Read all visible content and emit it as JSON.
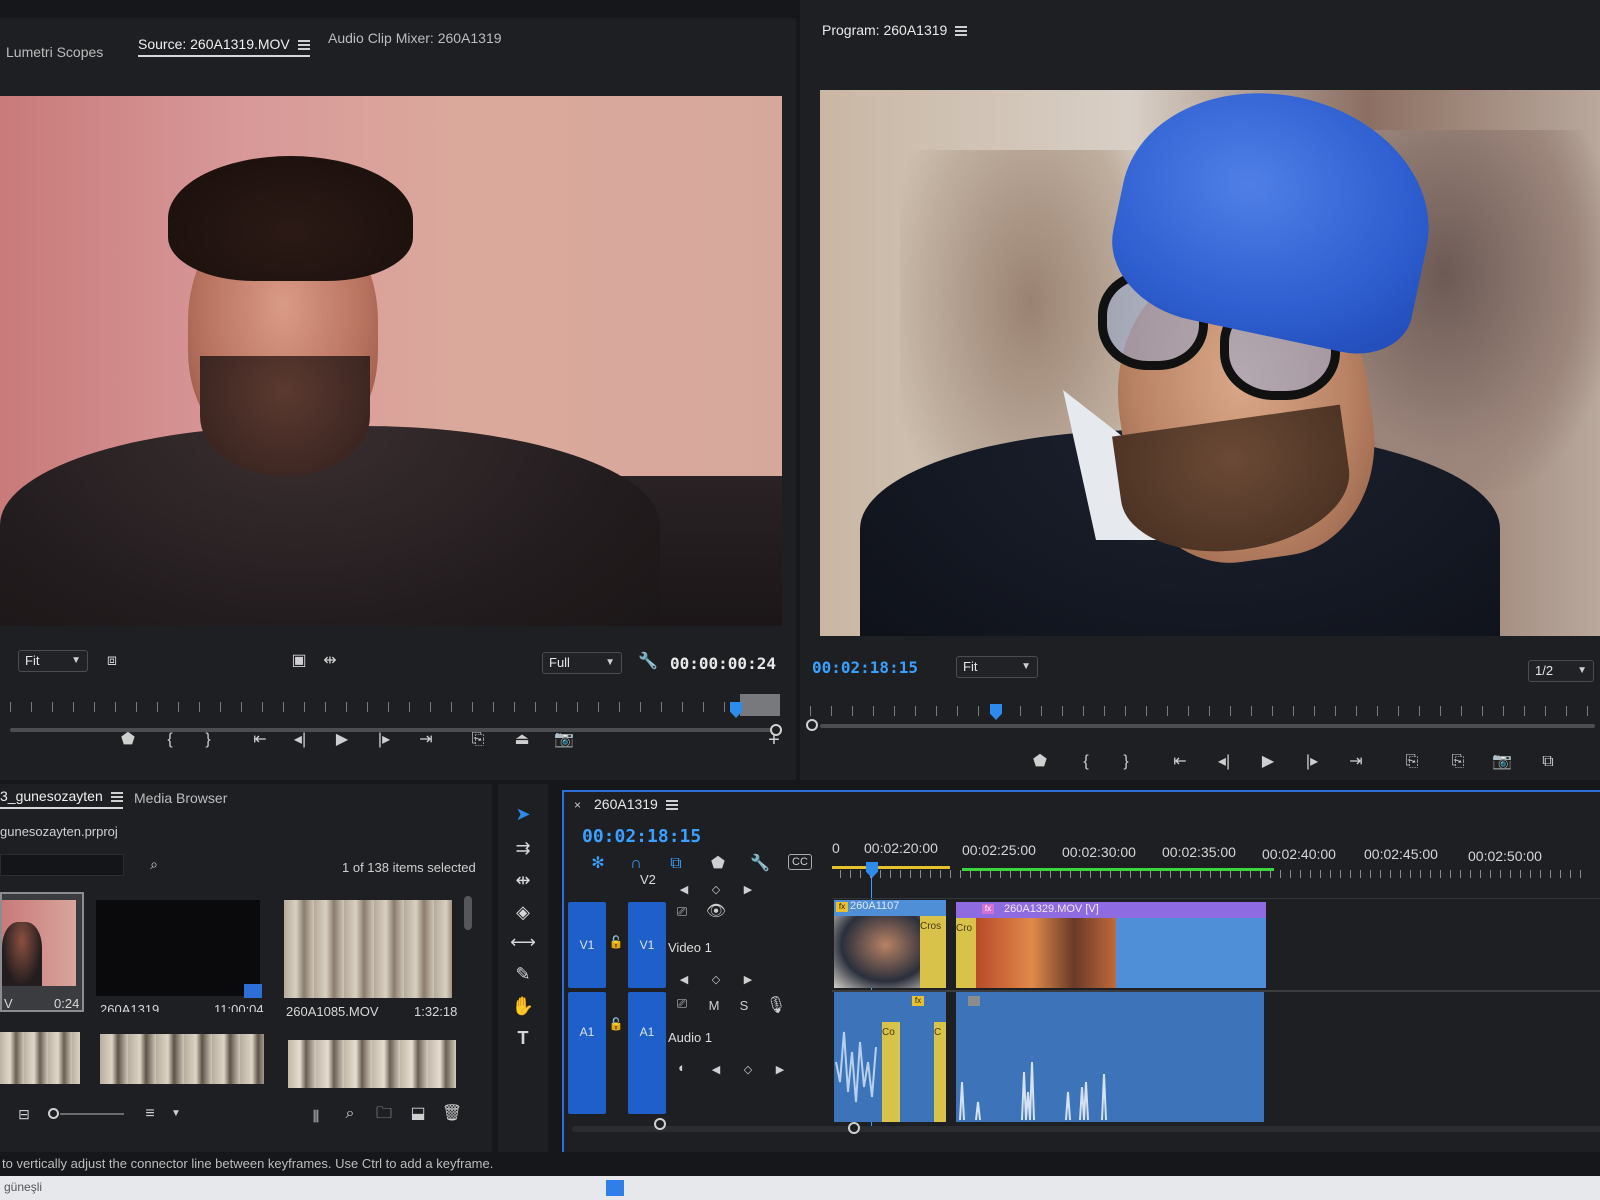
{
  "source_panel": {
    "tabs": [
      "Lumetri Scopes",
      "Source: 260A1319.MOV",
      "Audio Clip Mixer: 260A1319"
    ],
    "zoom": "Fit",
    "resolution": "Full",
    "timecode": "00:00:00:24",
    "add_button": "+"
  },
  "program_panel": {
    "title": "Program: 260A1319",
    "timecode": "00:02:18:15",
    "zoom": "Fit",
    "resolution": "1/2"
  },
  "project_panel": {
    "tab": "3_gunesozayten",
    "tab2": "Media Browser",
    "filename": "gunesozayten.prproj",
    "selection_status": "1 of 138 items selected",
    "items": [
      {
        "name": "V",
        "duration": "0:24"
      },
      {
        "name": "260A1319",
        "duration": "11:00:04"
      },
      {
        "name": "260A1085.MOV",
        "duration": "1:32:18"
      }
    ]
  },
  "timeline": {
    "sequence": "260A1319",
    "timecode": "00:02:18:15",
    "ruler": [
      "00:02:20:00",
      "00:02:25:00",
      "00:02:30:00",
      "00:02:35:00",
      "00:02:40:00",
      "00:02:45:00",
      "00:02:50:00"
    ],
    "tracks": {
      "v2": "V2",
      "v1_src": "V1",
      "v1": "V1",
      "video1": "Video 1",
      "a1_src": "A1",
      "a1": "A1",
      "audio1": "Audio 1",
      "m": "M",
      "s": "S"
    },
    "clips": {
      "clip1": "260A1107",
      "clip2": "260A1329.MOV [V]",
      "cross1": "Cros",
      "cross2": "Cro",
      "audio_co": "Co",
      "audio_c": "C"
    }
  },
  "status_bar": {
    "hint": "to vertically adjust the connector line between keyframes. Use Ctrl to add a keyframe.",
    "taskbar_text": "güneşli"
  },
  "colors": {
    "accent_blue": "#2d8ceb",
    "timecode_blue": "#3aa0ff",
    "track_blue": "#1f5fc9",
    "clip_blue": "#4f8fd8",
    "audio_blue": "#3d73b8",
    "clip_label_purple": "#8e6be0",
    "fx_yellow": "#e8c02c",
    "render_green": "#3cd63c"
  }
}
